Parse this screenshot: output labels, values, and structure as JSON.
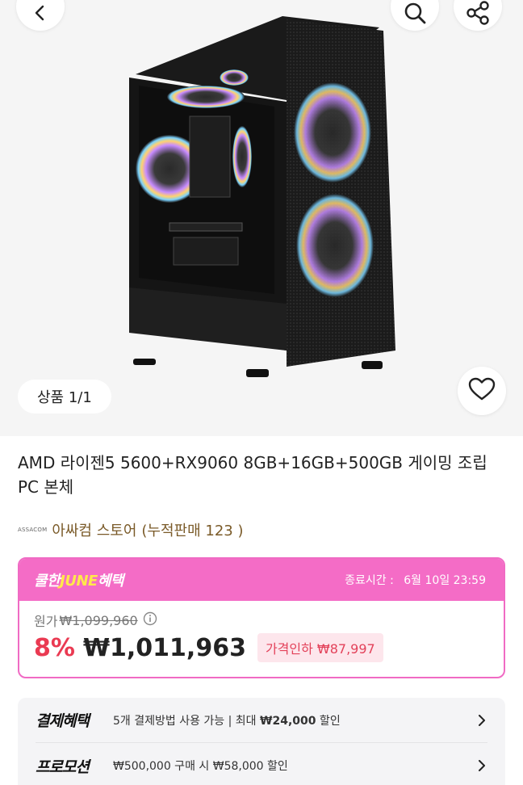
{
  "header": {
    "back_icon": "chevron-left-icon",
    "search_icon": "search-icon",
    "share_icon": "share-icon"
  },
  "gallery": {
    "counter": "상품 1/1",
    "wish_icon": "heart-icon"
  },
  "product": {
    "title": "AMD 라이젠5 5600+RX9060 8GB+16GB+500GB 게이밍 조립PC 본체"
  },
  "store": {
    "logo_text": "ASSACOM",
    "name": "아싸컴 스토어",
    "sales": "(누적판매 123 )"
  },
  "june_benefit": {
    "logo_prefix": "쿨한",
    "logo_highlight": "JUNE",
    "logo_suffix": "혜택",
    "end_label": "종료시간 :",
    "end_time": "6월 10일 23:59",
    "original_label": "원가",
    "original_price": "₩1,099,960",
    "discount_rate": "8%",
    "sale_price": "₩1,011,963",
    "price_cut": "가격인하 ₩87,997"
  },
  "benefits": [
    {
      "label": "결제혜택",
      "text_pre": "5개 결제방법 사용 가능 | 최대 ",
      "text_bold": "₩24,000",
      "text_post": " 할인"
    },
    {
      "label": "프로모션",
      "text_pre": "₩500,000 구매 시 ₩58,000 할인",
      "text_bold": "",
      "text_post": ""
    }
  ],
  "colors": {
    "accent_pink": "#f46cc6",
    "discount_red": "#ea3a52",
    "store_brown": "#7a5a28"
  }
}
